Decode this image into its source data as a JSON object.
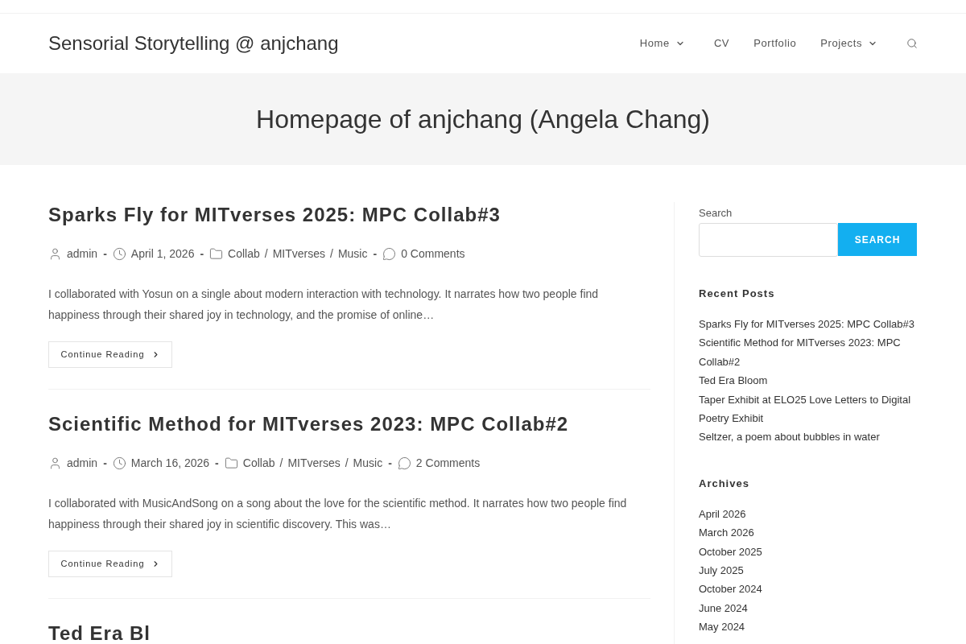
{
  "header": {
    "site_title": "Sensorial Storytelling @ anjchang",
    "nav": [
      {
        "label": "Home",
        "submenu": true
      },
      {
        "label": "CV",
        "submenu": false
      },
      {
        "label": "Portfolio",
        "submenu": false
      },
      {
        "label": "Projects",
        "submenu": true
      }
    ]
  },
  "page_header": {
    "title": "Homepage of anjchang (Angela Chang)"
  },
  "posts": [
    {
      "title": "Sparks Fly for MITverses 2025: MPC Collab#3",
      "meta": [
        {
          "kind": "author",
          "text": "admin"
        },
        {
          "kind": "separator",
          "text": "-"
        },
        {
          "kind": "date",
          "text": "April 1, 2026"
        },
        {
          "kind": "separator",
          "text": "-"
        },
        {
          "kind": "categories",
          "items": [
            {
              "kind": "link",
              "text": "Collab"
            },
            {
              "kind": "separator",
              "text": "/"
            },
            {
              "kind": "link",
              "text": "MITverses"
            },
            {
              "kind": "separator",
              "text": "/"
            },
            {
              "kind": "link",
              "text": "Music"
            }
          ]
        },
        {
          "kind": "separator",
          "text": "-"
        },
        {
          "kind": "comments",
          "text": "0 Comments"
        }
      ],
      "excerpt": "I collaborated with Yosun on a single about modern interaction with technology. It narrates how two people find happiness through their shared joy in technology, and the promise of online…",
      "button": "Continue Reading"
    },
    {
      "title": "Scientific Method for MITverses 2023: MPC Collab#2",
      "meta": [
        {
          "kind": "author",
          "text": "admin"
        },
        {
          "kind": "separator",
          "text": "-"
        },
        {
          "kind": "date",
          "text": "March 16, 2026"
        },
        {
          "kind": "separator",
          "text": "-"
        },
        {
          "kind": "categories",
          "items": [
            {
              "kind": "link",
              "text": "Collab"
            },
            {
              "kind": "separator",
              "text": "/"
            },
            {
              "kind": "link",
              "text": "MITverses"
            },
            {
              "kind": "separator",
              "text": "/"
            },
            {
              "kind": "link",
              "text": "Music"
            }
          ]
        },
        {
          "kind": "separator",
          "text": "-"
        },
        {
          "kind": "comments",
          "text": "2 Comments"
        }
      ],
      "excerpt": "I collaborated with MusicAndSong on a song about the love for the scientific method. It narrates how two people find happiness through their shared joy in scientific discovery. This was…",
      "button": "Continue Reading"
    },
    {
      "title": "Ted Era Bl"
    }
  ],
  "sidebar": {
    "search": {
      "label": "Search",
      "button": "SEARCH"
    },
    "widgets": [
      {
        "heading": "Recent Posts",
        "items": [
          "Sparks Fly for MITverses 2025: MPC Collab#3",
          "Scientific Method for MITverses 2023: MPC Collab#2",
          "Ted Era Bloom",
          "Taper Exhibit at ELO25 Love Letters to Digital Poetry Exhibit",
          "Seltzer, a poem about bubbles in water"
        ]
      },
      {
        "heading": "Archives",
        "items": [
          "April 2026",
          "March 2026",
          "October 2025",
          "July 2025",
          "October 2024",
          "June 2024",
          "May 2024"
        ]
      }
    ]
  }
}
